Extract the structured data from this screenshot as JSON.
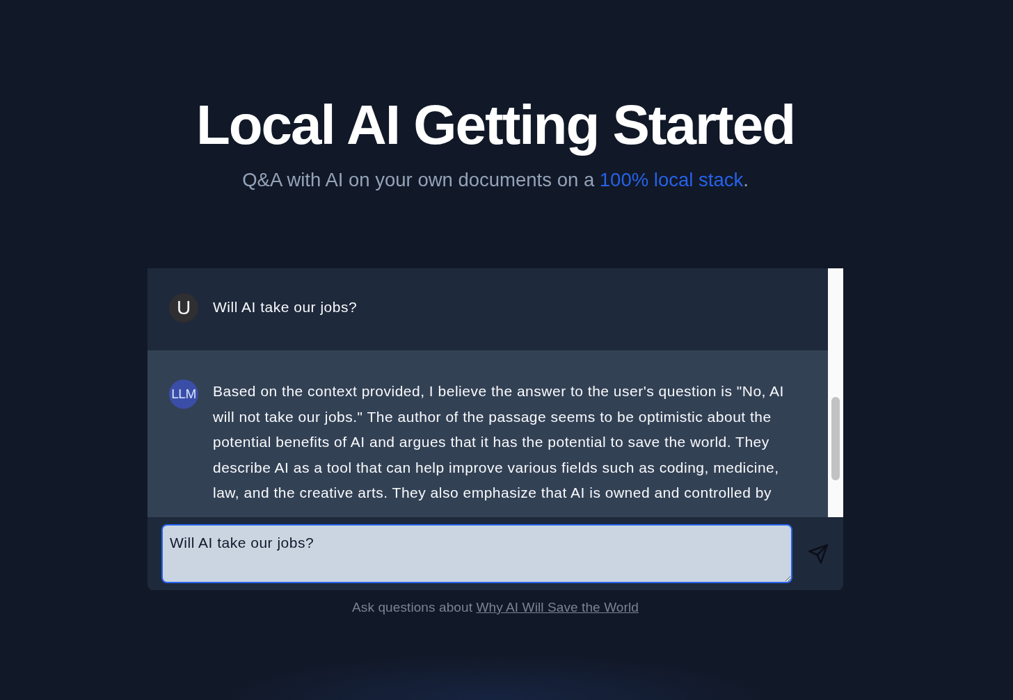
{
  "header": {
    "title": "Local AI Getting Started",
    "subtitle": {
      "text": "Q&A with AI on your own documents on a ",
      "link": "100% local stack",
      "end": "."
    }
  },
  "chat": {
    "messages": [
      {
        "kind": "user",
        "avatar": "U",
        "text": "Will AI take our jobs?"
      },
      {
        "kind": "llm",
        "avatar": "LLM",
        "text": "Based on the context provided, I believe the answer to the user's question is \"No, AI will not take our jobs.\" The author of the passage seems to be optimistic about the potential benefits of AI and argues that it has the potential to save the world. They describe AI as a tool that can help improve various fields such as coding, medicine, law, and the creative arts. They also emphasize that AI is owned and controlled by"
      }
    ],
    "input": {
      "value": "Will AI take our jobs?"
    }
  },
  "footer": {
    "text": "Ask questions about ",
    "link": "Why AI Will Save the World"
  }
}
